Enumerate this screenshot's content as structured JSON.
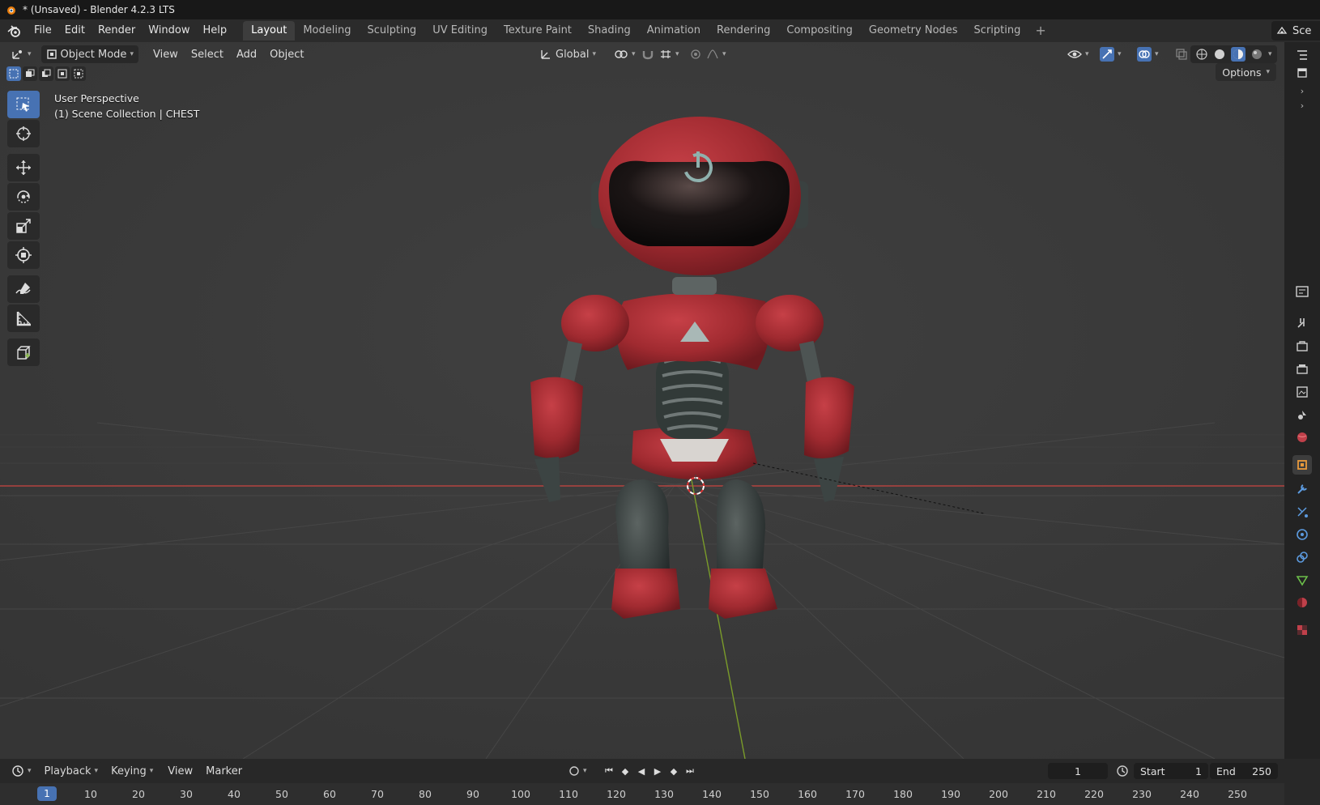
{
  "window": {
    "title": "* (Unsaved) - Blender 4.2.3 LTS"
  },
  "menu": [
    "File",
    "Edit",
    "Render",
    "Window",
    "Help"
  ],
  "workspaces": [
    "Layout",
    "Modeling",
    "Sculpting",
    "UV Editing",
    "Texture Paint",
    "Shading",
    "Animation",
    "Rendering",
    "Compositing",
    "Geometry Nodes",
    "Scripting"
  ],
  "active_workspace": "Layout",
  "scene_selector": "Sce",
  "viewport_header": {
    "mode": "Object Mode",
    "menus": [
      "View",
      "Select",
      "Add",
      "Object"
    ],
    "transform_orientation": "Global",
    "options_label": "Options"
  },
  "overlay": {
    "view_name": "User Perspective",
    "collection_info": "(1) Scene Collection | CHEST"
  },
  "tools": [
    "select-box",
    "cursor",
    "move",
    "rotate",
    "scale",
    "transform",
    "annotate",
    "measure",
    "add-cube"
  ],
  "timeline": {
    "menus": [
      "Playback",
      "Keying",
      "View",
      "Marker"
    ],
    "current_frame": "1",
    "start_label": "Start",
    "start_value": "1",
    "end_label": "End",
    "end_value": "250",
    "ruler_ticks": [
      "1",
      "10",
      "20",
      "30",
      "40",
      "50",
      "60",
      "70",
      "80",
      "90",
      "100",
      "110",
      "120",
      "130",
      "140",
      "150",
      "160",
      "170",
      "180",
      "190",
      "200",
      "210",
      "220",
      "230",
      "240",
      "250"
    ]
  },
  "colors": {
    "accent": "#4772b3",
    "robot_red": "#a72b31",
    "x_axis": "#b3433f",
    "y_axis": "#7a9b2a"
  },
  "properties_icons": [
    "tool",
    "render",
    "output",
    "view-layer",
    "scene",
    "world",
    "object",
    "modifier",
    "particles",
    "physics",
    "constraints",
    "data",
    "material",
    "texture"
  ]
}
